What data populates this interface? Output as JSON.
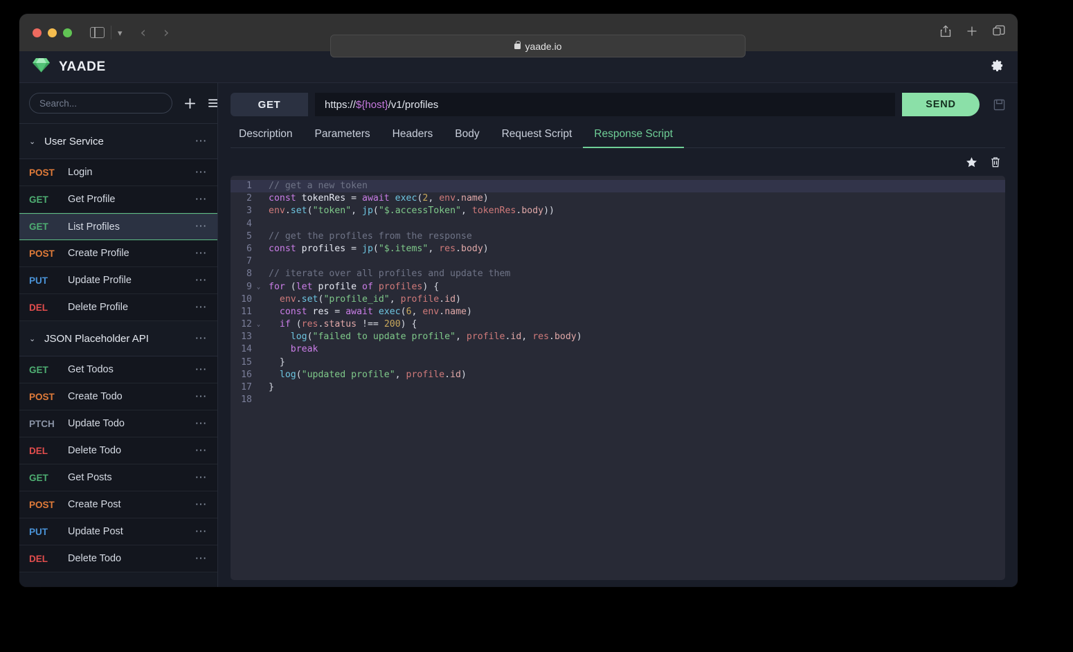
{
  "browser": {
    "url_text": "yaade.io",
    "lock_icon": "lock-icon",
    "back_icon": "chevron-left-icon",
    "forward_icon": "chevron-right-icon",
    "sidebar_icon": "sidebar-toggle-icon",
    "dropdown_icon": "chevron-down-icon",
    "share_icon": "share-icon",
    "newtab_icon": "plus-icon",
    "tabs_icon": "tabs-overview-icon"
  },
  "app": {
    "title": "YAADE",
    "logo_icon": "gem-icon",
    "settings_icon": "gear-icon"
  },
  "sidebar": {
    "search": {
      "placeholder": "Search...",
      "value": ""
    },
    "add_icon": "plus-icon",
    "menu_icon": "hamburger-menu-icon",
    "groups": [
      {
        "name": "User Service",
        "caret": "⌄",
        "more": "⋯",
        "requests": [
          {
            "method": "POST",
            "name": "Login",
            "selected": false
          },
          {
            "method": "GET",
            "name": "Get Profile",
            "selected": false
          },
          {
            "method": "GET",
            "name": "List Profiles",
            "selected": true
          },
          {
            "method": "POST",
            "name": "Create Profile",
            "selected": false
          },
          {
            "method": "PUT",
            "name": "Update Profile",
            "selected": false
          },
          {
            "method": "DEL",
            "name": "Delete Profile",
            "selected": false
          }
        ]
      },
      {
        "name": "JSON Placeholder API",
        "caret": "⌄",
        "more": "⋯",
        "requests": [
          {
            "method": "GET",
            "name": "Get Todos",
            "selected": false
          },
          {
            "method": "POST",
            "name": "Create Todo",
            "selected": false
          },
          {
            "method": "PTCH",
            "name": "Update Todo",
            "selected": false
          },
          {
            "method": "DEL",
            "name": "Delete Todo",
            "selected": false
          },
          {
            "method": "GET",
            "name": "Get Posts",
            "selected": false
          },
          {
            "method": "POST",
            "name": "Create Post",
            "selected": false
          },
          {
            "method": "PUT",
            "name": "Update Post",
            "selected": false
          },
          {
            "method": "DEL",
            "name": "Delete Todo",
            "selected": false
          }
        ]
      }
    ]
  },
  "request": {
    "method": "GET",
    "url_prefix": "https://",
    "url_variable": "${host}",
    "url_suffix": "/v1/profiles",
    "url_full": "https://${host}/v1/profiles",
    "send_label": "SEND",
    "save_icon": "floppy-disk-icon",
    "tabs": [
      {
        "label": "Description",
        "active": false
      },
      {
        "label": "Parameters",
        "active": false
      },
      {
        "label": "Headers",
        "active": false
      },
      {
        "label": "Body",
        "active": false
      },
      {
        "label": "Request Script",
        "active": false
      },
      {
        "label": "Response Script",
        "active": true
      }
    ],
    "editor_tools": [
      {
        "icon": "star-icon",
        "glyph": "★"
      },
      {
        "icon": "trash-icon",
        "glyph": "trash"
      }
    ]
  },
  "editor": {
    "active_line": 1,
    "lines": [
      {
        "n": 1,
        "fold": "",
        "tokens": [
          {
            "t": "// get a new token",
            "c": "c-com"
          }
        ]
      },
      {
        "n": 2,
        "fold": "",
        "tokens": [
          {
            "t": "const",
            "c": "c-kw"
          },
          {
            "t": " tokenRes ",
            "c": "c-pln"
          },
          {
            "t": "=",
            "c": "c-op"
          },
          {
            "t": " ",
            "c": "c-pln"
          },
          {
            "t": "await",
            "c": "c-kw"
          },
          {
            "t": " ",
            "c": "c-pln"
          },
          {
            "t": "exec",
            "c": "c-fn"
          },
          {
            "t": "(",
            "c": "c-op"
          },
          {
            "t": "2",
            "c": "c-num"
          },
          {
            "t": ", ",
            "c": "c-op"
          },
          {
            "t": "env",
            "c": "c-var"
          },
          {
            "t": ".",
            "c": "c-op"
          },
          {
            "t": "name",
            "c": "c-prop"
          },
          {
            "t": ")",
            "c": "c-op"
          }
        ]
      },
      {
        "n": 3,
        "fold": "",
        "tokens": [
          {
            "t": "env",
            "c": "c-var"
          },
          {
            "t": ".",
            "c": "c-op"
          },
          {
            "t": "set",
            "c": "c-fn"
          },
          {
            "t": "(",
            "c": "c-op"
          },
          {
            "t": "\"token\"",
            "c": "c-str"
          },
          {
            "t": ", ",
            "c": "c-op"
          },
          {
            "t": "jp",
            "c": "c-fn"
          },
          {
            "t": "(",
            "c": "c-op"
          },
          {
            "t": "\"$.accessToken\"",
            "c": "c-str"
          },
          {
            "t": ", ",
            "c": "c-op"
          },
          {
            "t": "tokenRes",
            "c": "c-var"
          },
          {
            "t": ".",
            "c": "c-op"
          },
          {
            "t": "body",
            "c": "c-prop"
          },
          {
            "t": "))",
            "c": "c-op"
          }
        ]
      },
      {
        "n": 4,
        "fold": "",
        "tokens": []
      },
      {
        "n": 5,
        "fold": "",
        "tokens": [
          {
            "t": "// get the profiles from the response",
            "c": "c-com"
          }
        ]
      },
      {
        "n": 6,
        "fold": "",
        "tokens": [
          {
            "t": "const",
            "c": "c-kw"
          },
          {
            "t": " profiles ",
            "c": "c-pln"
          },
          {
            "t": "=",
            "c": "c-op"
          },
          {
            "t": " ",
            "c": "c-pln"
          },
          {
            "t": "jp",
            "c": "c-fn"
          },
          {
            "t": "(",
            "c": "c-op"
          },
          {
            "t": "\"$.items\"",
            "c": "c-str"
          },
          {
            "t": ", ",
            "c": "c-op"
          },
          {
            "t": "res",
            "c": "c-var"
          },
          {
            "t": ".",
            "c": "c-op"
          },
          {
            "t": "body",
            "c": "c-prop"
          },
          {
            "t": ")",
            "c": "c-op"
          }
        ]
      },
      {
        "n": 7,
        "fold": "",
        "tokens": []
      },
      {
        "n": 8,
        "fold": "",
        "tokens": [
          {
            "t": "// iterate over all profiles and update them",
            "c": "c-com"
          }
        ]
      },
      {
        "n": 9,
        "fold": "⌄",
        "tokens": [
          {
            "t": "for",
            "c": "c-kw"
          },
          {
            "t": " (",
            "c": "c-op"
          },
          {
            "t": "let",
            "c": "c-kw"
          },
          {
            "t": " profile ",
            "c": "c-pln"
          },
          {
            "t": "of",
            "c": "c-kw"
          },
          {
            "t": " ",
            "c": "c-pln"
          },
          {
            "t": "profiles",
            "c": "c-var"
          },
          {
            "t": ") {",
            "c": "c-op"
          }
        ]
      },
      {
        "n": 10,
        "fold": "",
        "tokens": [
          {
            "t": "  ",
            "c": "c-pln"
          },
          {
            "t": "env",
            "c": "c-var"
          },
          {
            "t": ".",
            "c": "c-op"
          },
          {
            "t": "set",
            "c": "c-fn"
          },
          {
            "t": "(",
            "c": "c-op"
          },
          {
            "t": "\"profile_id\"",
            "c": "c-str"
          },
          {
            "t": ", ",
            "c": "c-op"
          },
          {
            "t": "profile",
            "c": "c-var"
          },
          {
            "t": ".",
            "c": "c-op"
          },
          {
            "t": "id",
            "c": "c-prop"
          },
          {
            "t": ")",
            "c": "c-op"
          }
        ]
      },
      {
        "n": 11,
        "fold": "",
        "tokens": [
          {
            "t": "  ",
            "c": "c-pln"
          },
          {
            "t": "const",
            "c": "c-kw"
          },
          {
            "t": " res ",
            "c": "c-pln"
          },
          {
            "t": "=",
            "c": "c-op"
          },
          {
            "t": " ",
            "c": "c-pln"
          },
          {
            "t": "await",
            "c": "c-kw"
          },
          {
            "t": " ",
            "c": "c-pln"
          },
          {
            "t": "exec",
            "c": "c-fn"
          },
          {
            "t": "(",
            "c": "c-op"
          },
          {
            "t": "6",
            "c": "c-num"
          },
          {
            "t": ", ",
            "c": "c-op"
          },
          {
            "t": "env",
            "c": "c-var"
          },
          {
            "t": ".",
            "c": "c-op"
          },
          {
            "t": "name",
            "c": "c-prop"
          },
          {
            "t": ")",
            "c": "c-op"
          }
        ]
      },
      {
        "n": 12,
        "fold": "⌄",
        "tokens": [
          {
            "t": "  ",
            "c": "c-pln"
          },
          {
            "t": "if",
            "c": "c-kw"
          },
          {
            "t": " (",
            "c": "c-op"
          },
          {
            "t": "res",
            "c": "c-var"
          },
          {
            "t": ".",
            "c": "c-op"
          },
          {
            "t": "status",
            "c": "c-prop"
          },
          {
            "t": " ",
            "c": "c-pln"
          },
          {
            "t": "!==",
            "c": "c-op"
          },
          {
            "t": " ",
            "c": "c-pln"
          },
          {
            "t": "200",
            "c": "c-num"
          },
          {
            "t": ") {",
            "c": "c-op"
          }
        ]
      },
      {
        "n": 13,
        "fold": "",
        "tokens": [
          {
            "t": "    ",
            "c": "c-pln"
          },
          {
            "t": "log",
            "c": "c-fn"
          },
          {
            "t": "(",
            "c": "c-op"
          },
          {
            "t": "\"failed to update profile\"",
            "c": "c-str"
          },
          {
            "t": ", ",
            "c": "c-op"
          },
          {
            "t": "profile",
            "c": "c-var"
          },
          {
            "t": ".",
            "c": "c-op"
          },
          {
            "t": "id",
            "c": "c-prop"
          },
          {
            "t": ", ",
            "c": "c-op"
          },
          {
            "t": "res",
            "c": "c-var"
          },
          {
            "t": ".",
            "c": "c-op"
          },
          {
            "t": "body",
            "c": "c-prop"
          },
          {
            "t": ")",
            "c": "c-op"
          }
        ]
      },
      {
        "n": 14,
        "fold": "",
        "tokens": [
          {
            "t": "    ",
            "c": "c-pln"
          },
          {
            "t": "break",
            "c": "c-kw"
          }
        ]
      },
      {
        "n": 15,
        "fold": "",
        "tokens": [
          {
            "t": "  }",
            "c": "c-op"
          }
        ]
      },
      {
        "n": 16,
        "fold": "",
        "tokens": [
          {
            "t": "  ",
            "c": "c-pln"
          },
          {
            "t": "log",
            "c": "c-fn"
          },
          {
            "t": "(",
            "c": "c-op"
          },
          {
            "t": "\"updated profile\"",
            "c": "c-str"
          },
          {
            "t": ", ",
            "c": "c-op"
          },
          {
            "t": "profile",
            "c": "c-var"
          },
          {
            "t": ".",
            "c": "c-op"
          },
          {
            "t": "id",
            "c": "c-prop"
          },
          {
            "t": ")",
            "c": "c-op"
          }
        ]
      },
      {
        "n": 17,
        "fold": "",
        "tokens": [
          {
            "t": "}",
            "c": "c-op"
          }
        ]
      },
      {
        "n": 18,
        "fold": "",
        "tokens": []
      }
    ]
  },
  "colors": {
    "accent_green": "#6fcf97",
    "send_green": "#8be0a8",
    "method_get": "#4eae72",
    "method_post": "#e07b39",
    "method_put": "#4a93d8",
    "method_del": "#e24d4d",
    "method_patch": "#8a93a5",
    "url_variable": "#c87ae0",
    "editor_bg": "#282a36",
    "app_bg": "#191d28",
    "sidebar_bg": "#161a23"
  }
}
